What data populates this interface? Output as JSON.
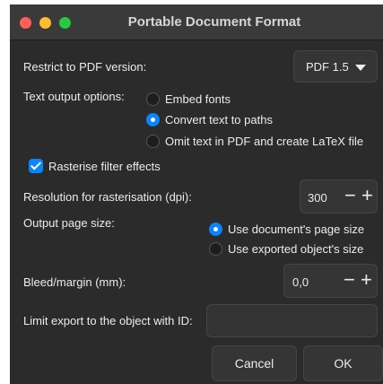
{
  "window": {
    "title": "Portable Document Format"
  },
  "pdf_version": {
    "label": "Restrict to PDF version:",
    "selected": "PDF 1.5"
  },
  "text_output": {
    "label": "Text output options:",
    "options": [
      {
        "label": "Embed fonts",
        "selected": false
      },
      {
        "label": "Convert text to paths",
        "selected": true
      },
      {
        "label": "Omit text in PDF and create LaTeX file",
        "selected": false
      }
    ]
  },
  "rasterise": {
    "label": "Rasterise filter effects",
    "checked": true
  },
  "resolution": {
    "label": "Resolution for rasterisation (dpi):",
    "value": "300"
  },
  "page_size": {
    "label": "Output page size:",
    "options": [
      {
        "label": "Use document's page size",
        "selected": true
      },
      {
        "label": "Use exported object's size",
        "selected": false
      }
    ]
  },
  "bleed": {
    "label": "Bleed/margin (mm):",
    "value": "0,0"
  },
  "limit_export": {
    "label": "Limit export to the object with ID:",
    "value": ""
  },
  "buttons": {
    "cancel": "Cancel",
    "ok": "OK"
  },
  "colors": {
    "accent": "#0a84ff",
    "background": "#2b2b2b",
    "titlebar": "#3a3a3a"
  }
}
